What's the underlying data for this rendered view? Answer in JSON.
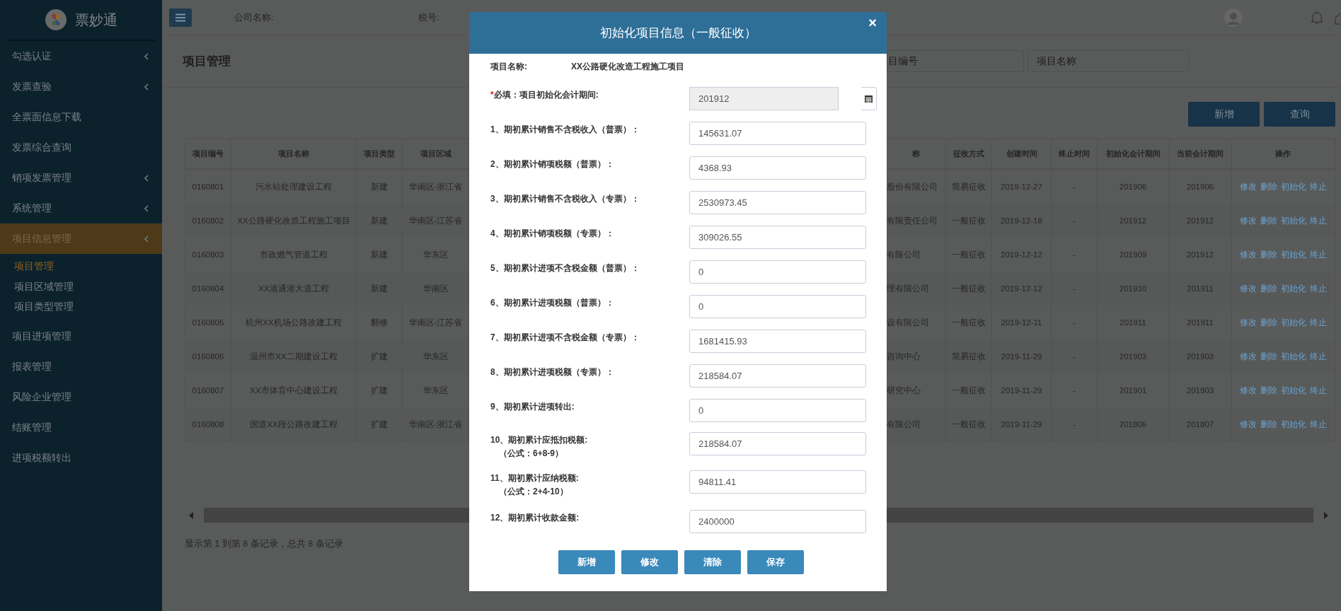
{
  "sidebar": {
    "logo_text": "票妙通",
    "items": [
      {
        "label": "勾选认证",
        "has_submenu": true,
        "selected": false
      },
      {
        "label": "发票查验",
        "has_submenu": true,
        "selected": false
      },
      {
        "label": "全票面信息下载",
        "has_submenu": false,
        "selected": false
      },
      {
        "label": "发票综合查询",
        "has_submenu": false,
        "selected": false
      },
      {
        "label": "销项发票管理",
        "has_submenu": true,
        "selected": false
      },
      {
        "label": "系统管理",
        "has_submenu": true,
        "selected": false
      },
      {
        "label": "项目信息管理",
        "has_submenu": true,
        "selected": true,
        "children": [
          {
            "label": "项目管理",
            "selected": true
          },
          {
            "label": "项目区域管理",
            "selected": false
          },
          {
            "label": "项目类型管理",
            "selected": false
          }
        ]
      },
      {
        "label": "项目进项管理",
        "has_submenu": false,
        "selected": false
      },
      {
        "label": "报表管理",
        "has_submenu": false,
        "selected": false
      },
      {
        "label": "风险企业管理",
        "has_submenu": false,
        "selected": false
      },
      {
        "label": "结账管理",
        "has_submenu": false,
        "selected": false
      },
      {
        "label": "进项税额转出",
        "has_submenu": false,
        "selected": false
      }
    ]
  },
  "topbar": {
    "company_label": "公司名称:",
    "tax_label": "税号:"
  },
  "page": {
    "title": "项目管理",
    "search": [
      {
        "placeholder": "目编号"
      },
      {
        "placeholder": "项目名称"
      }
    ],
    "buttons": [
      "新增",
      "查询"
    ]
  },
  "table": {
    "columns": [
      "项目编号",
      "项目名称",
      "项目类型",
      "项目区域",
      "称",
      "征收方式",
      "创建时间",
      "终止时间",
      "初始化会计期间",
      "当前会计期间",
      "操作"
    ],
    "rows": [
      {
        "cells": [
          "0160801",
          "污水站处理建设工程",
          "新建",
          "华南区-浙江省",
          "股份有限公司",
          "简易征收",
          "2019-12-27",
          "-",
          "201906",
          "201906"
        ],
        "actions": [
          "修改",
          "删除",
          "初始化",
          "终止"
        ]
      },
      {
        "cells": [
          "0160802",
          "XX公路硬化改造工程施工项目",
          "新建",
          "华南区-江苏省",
          "有限责任公司",
          "一般征收",
          "2019-12-18",
          "-",
          "201912",
          "201912"
        ],
        "actions": [
          "修改",
          "删除",
          "初始化",
          "终止"
        ]
      },
      {
        "cells": [
          "0160803",
          "市政燃气管道工程",
          "新建",
          "华东区",
          "有限公司",
          "一般征收",
          "2019-12-12",
          "-",
          "201909",
          "201912"
        ],
        "actions": [
          "修改",
          "删除",
          "初始化",
          "终止"
        ]
      },
      {
        "cells": [
          "0160804",
          "XX港通港大道工程",
          "新建",
          "华南区",
          "理有限公司",
          "一般征收",
          "2019-12-12",
          "-",
          "201910",
          "201911"
        ],
        "actions": [
          "修改",
          "删除",
          "初始化",
          "终止"
        ]
      },
      {
        "cells": [
          "0160805",
          "杭州XX机场公路改建工程",
          "翻修",
          "华南区-江苏省",
          "设有限公司",
          "一般征收",
          "2019-12-11",
          "-",
          "201911",
          "201911"
        ],
        "actions": [
          "修改",
          "删除",
          "初始化",
          "终止"
        ]
      },
      {
        "cells": [
          "0160806",
          "温州市XX二期建设工程",
          "扩建",
          "华东区",
          "咨询中心",
          "简易征收",
          "2019-11-29",
          "-",
          "201903",
          "201903"
        ],
        "actions": [
          "修改",
          "删除",
          "初始化",
          "终止"
        ]
      },
      {
        "cells": [
          "0160807",
          "XX市体育中心建设工程",
          "扩建",
          "华东区",
          "研究中心",
          "一般征收",
          "2019-11-29",
          "-",
          "201901",
          "201903"
        ],
        "actions": [
          "修改",
          "删除",
          "初始化",
          "终止"
        ]
      },
      {
        "cells": [
          "0160808",
          "国道XX段公路改建工程",
          "扩建",
          "华南区-浙江省",
          "有限公司",
          "一般征收",
          "2019-11-29",
          "-",
          "201806",
          "201807"
        ],
        "actions": [
          "修改",
          "删除",
          "初始化",
          "终止"
        ]
      }
    ],
    "footer": "显示第 1 到第 8 条记录，总共 8 条记录"
  },
  "dialog": {
    "title": "初始化项目信息（一般征收）",
    "close": "×",
    "project_label": "项目名称:",
    "project_name": "XX公路硬化改造工程施工项目",
    "required": {
      "mark": "*",
      "label": "必填：项目初始化会计期间:",
      "value": "201912",
      "disabled": true
    },
    "fields": [
      {
        "label": "1、期初累计销售不含税收入（普票）：",
        "value": "145631.07"
      },
      {
        "label": "2、期初累计销项税额（普票）：",
        "value": "4368.93"
      },
      {
        "label": "3、期初累计销售不含税收入（专票）：",
        "value": "2530973.45"
      },
      {
        "label": "4、期初累计销项税额（专票）：",
        "value": "309026.55"
      },
      {
        "label": "5、期初累计进项不含税金额（普票）：",
        "value": "0"
      },
      {
        "label": "6、期初累计进项税额（普票）：",
        "value": "0"
      },
      {
        "label": "7、期初累计进项不含税金额（专票）：",
        "value": "1681415.93"
      },
      {
        "label": "8、期初累计进项税额（专票）：",
        "value": "218584.07"
      },
      {
        "label": "9、期初累计进项转出:",
        "value": "0"
      },
      {
        "label": "10、期初累计应抵扣税额:",
        "formula": "（公式：6+8-9）",
        "value": "218584.07"
      },
      {
        "label": "11、期初累计应纳税额:",
        "formula": "（公式：2+4-10）",
        "value": "94811.41"
      },
      {
        "label": "12、期初累计收款金额:",
        "value": "2400000"
      }
    ],
    "buttons": [
      "新增",
      "修改",
      "清除",
      "保存"
    ]
  }
}
